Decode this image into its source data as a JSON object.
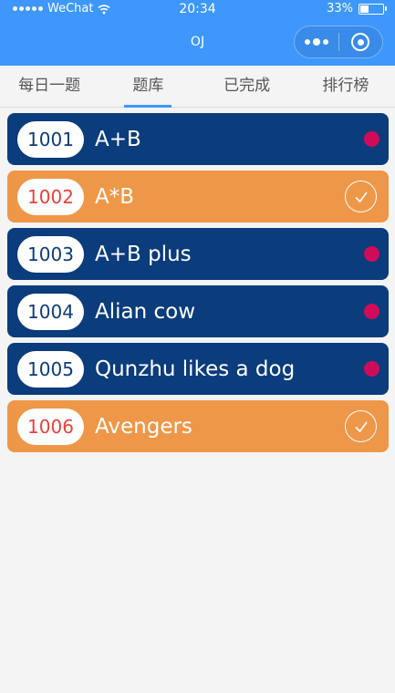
{
  "status_bar": {
    "carrier": "WeChat",
    "time": "20:34",
    "battery": "33%",
    "battery_level": 0.33
  },
  "nav": {
    "title": "OJ"
  },
  "tabs": [
    {
      "label": "每日一题",
      "active": false
    },
    {
      "label": "题库",
      "active": true
    },
    {
      "label": "已完成",
      "active": false
    },
    {
      "label": "排行榜",
      "active": false
    }
  ],
  "problems": [
    {
      "id": "1001",
      "title": "A+B",
      "status": "pending"
    },
    {
      "id": "1002",
      "title": "A*B",
      "status": "done"
    },
    {
      "id": "1003",
      "title": "A+B plus",
      "status": "pending"
    },
    {
      "id": "1004",
      "title": "Alian cow",
      "status": "pending"
    },
    {
      "id": "1005",
      "title": "Qunzhu likes a dog",
      "status": "pending"
    },
    {
      "id": "1006",
      "title": "Avengers",
      "status": "done"
    }
  ],
  "colors": {
    "accent": "#3d97fc",
    "pending_card": "#0b3c7c",
    "done_card": "#ef9748",
    "pending_dot": "#d00c5a",
    "done_number": "#e8423a"
  }
}
